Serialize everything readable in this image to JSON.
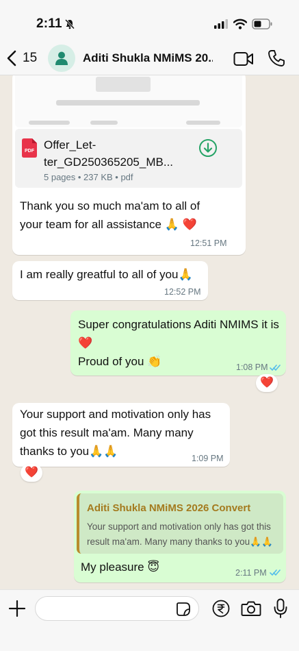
{
  "status_bar": {
    "time": "2:11"
  },
  "header": {
    "back_count": "15",
    "contact_name": "Aditi Shukla NMiMS 20..."
  },
  "messages": {
    "doc": {
      "file_name": "Offer_Let-ter_GD250365205_MB...",
      "meta": "5 pages • 237 KB • pdf",
      "text": "Thank you so much ma'am to all of your team for all assistance 🙏 ❤️",
      "time": "12:51 PM"
    },
    "m2": {
      "text": "I am really greatful to all of you🙏",
      "time": "12:52 PM"
    },
    "m3": {
      "line1": "Super congratulations Aditi NMIMS it is ❤️",
      "line2": "Proud of you 👏",
      "time": "1:08 PM",
      "reaction": "❤️"
    },
    "m4": {
      "text": "Your support and motivation only has got this result ma'am.  Many many thanks to you🙏🙏",
      "time": "1:09 PM",
      "reaction": "❤️"
    },
    "m5": {
      "quote_name": "Aditi Shukla NMiMS 2026 Convert",
      "quote_text": "Your support and motivation only has got this result ma'am.  Many many thanks to you🙏🙏",
      "text": "My pleasure 😇",
      "time": "2:11 PM"
    }
  },
  "composer": {
    "placeholder": ""
  },
  "colors": {
    "incoming": "#ffffff",
    "outgoing": "#d9fdd3",
    "accent": "#25a366",
    "read_ticks": "#53bdeb",
    "quote_name": "#a47a1e"
  }
}
